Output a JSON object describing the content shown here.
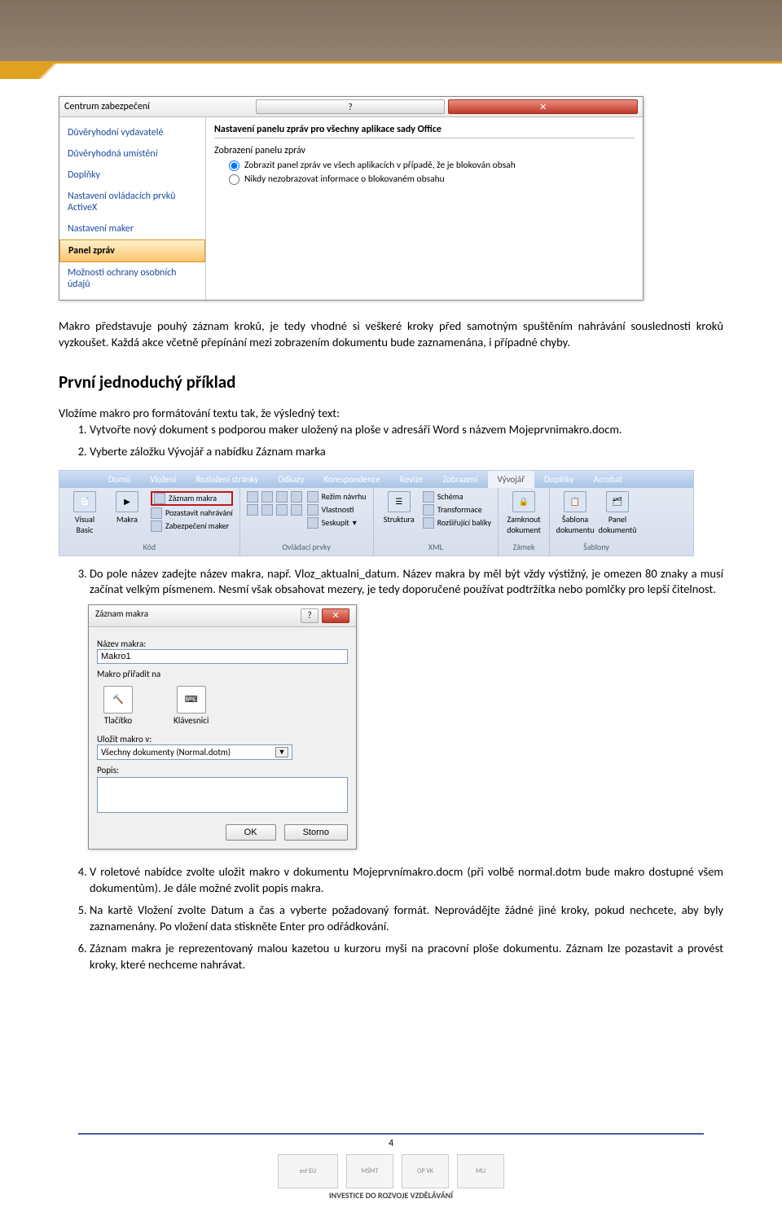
{
  "dialog1": {
    "title": "Centrum zabezpečení",
    "nav": [
      "Důvěryhodní vydavatelé",
      "Důvěryhodná umístění",
      "Doplňky",
      "Nastavení ovládacích prvků ActiveX",
      "Nastavení maker",
      "Panel zpráv",
      "Možnosti ochrany osobních údajů"
    ],
    "panel_title": "Nastavení panelu zpráv pro všechny aplikace sady Office",
    "panel_sub": "Zobrazení panelu zpráv",
    "radio1": "Zobrazit panel zpráv ve všech aplikacích v případě, že je blokován obsah",
    "radio2": "Nikdy nezobrazovat informace o blokovaném obsahu"
  },
  "para1": "Makro představuje pouhý záznam kroků, je tedy vhodné si veškeré kroky před samotným spuštěním nahrávání souslednosti kroků vyzkoušet. Každá akce včetně přepínání mezi zobrazením dokumentu bude zaznamenána, i případné chyby.",
  "heading_example": "První jednoduchý příklad",
  "para2": "Vložíme makro pro formátování textu tak, že výsledný text:",
  "li1": "Vytvořte nový dokument s podporou maker uložený na ploše v adresáři Word s názvem Mojeprvnimakro.docm.",
  "li2": "Vyberte záložku Vývojář a nabídku Záznam marka",
  "ribbon": {
    "tabs": [
      "Domů",
      "Vložení",
      "Rozložení stránky",
      "Odkazy",
      "Korespondence",
      "Revize",
      "Zobrazení",
      "Vývojář",
      "Doplňky",
      "Acrobat"
    ],
    "record": "Záznam makra",
    "pause": "Pozastavit nahrávání",
    "security": "Zabezpečení maker",
    "visual_basic": "Visual Basic",
    "makra": "Makra",
    "group_kod": "Kód",
    "design_mode": "Režim návrhu",
    "properties": "Vlastnosti",
    "group_box": "Seskupit",
    "group_ctrls": "Ovládací prvky",
    "struktura": "Struktura",
    "schema": "Schéma",
    "transform": "Transformace",
    "rozsir": "Rozšiřující balíky",
    "group_xml": "XML",
    "zamknout": "Zamknout dokument",
    "group_zamek": "Zámek",
    "sablona": "Šablona dokumentu",
    "panel_dok": "Panel dokumentů",
    "group_sablony": "Šablony"
  },
  "li3": "Do pole název zadejte název makra, např. Vloz_aktualni_datum. Název makra by měl být vždy výstižný, je omezen 80 znaky a musí začínat velkým písmenem. Nesmí však obsahovat mezery, je tedy doporučené používat podtržítka nebo pomlčky pro lepší čitelnost.",
  "dialog2": {
    "title": "Záznam makra",
    "name_label": "Název makra:",
    "name_value": "Makro1",
    "assign_label": "Makro přiřadit na",
    "btn_button": "Tlačítko",
    "btn_keyboard": "Klávesnici",
    "store_label": "Uložit makro v:",
    "store_value": "Všechny dokumenty (Normal.dotm)",
    "desc_label": "Popis:",
    "ok": "OK",
    "cancel": "Storno"
  },
  "li4": "V roletové nabídce zvolte uložit makro v dokumentu Mojeprvnímakro.docm (při volbě normal.dotm bude makro dostupné všem dokumentům). Je dále možné zvolit popis makra.",
  "li5": "Na kartě Vložení zvolte Datum a čas a vyberte požadovaný formát. Neprovádějte žádné jiné kroky, pokud nechcete, aby byly zaznamenány. Po vložení data stiskněte Enter pro odřádkování.",
  "li6": "Záznam makra je reprezentovaný malou kazetou u kurzoru myši na pracovní ploše dokumentu. Záznam lze pozastavit a provést kroky, které nechceme nahrávat.",
  "page_number": "4",
  "footer_label": "INVESTICE DO ROZVOJE VZDĚLÁVÁNÍ"
}
